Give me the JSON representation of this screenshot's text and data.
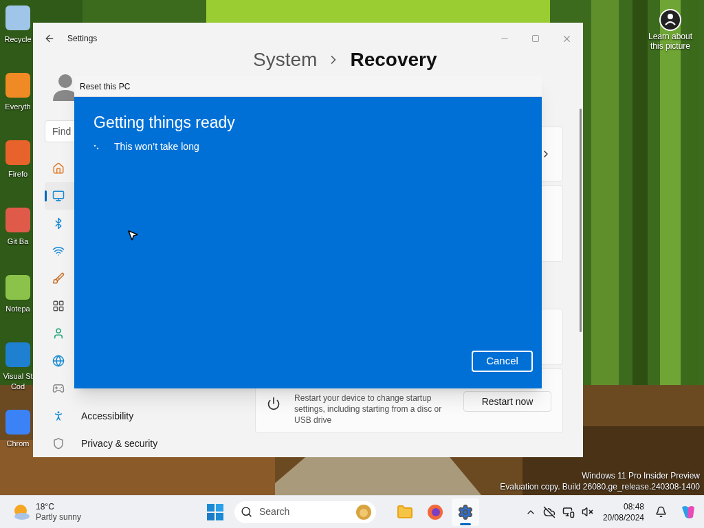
{
  "desktop": {
    "icons": [
      {
        "label": "Recycle"
      },
      {
        "label": "Everyth"
      },
      {
        "label": "Firefo"
      },
      {
        "label": "Git Ba"
      },
      {
        "label": "Notepa"
      },
      {
        "label": "Visual St\nCod"
      },
      {
        "label": "Chrom"
      }
    ],
    "learn_picture": "Learn about this picture",
    "build_notice": [
      "Windows 11 Pro Insider Preview",
      "Evaluation copy. Build 26080.ge_release.240308-1400"
    ]
  },
  "settings_window": {
    "title": "Settings",
    "search": {
      "placeholder": "Find"
    },
    "breadcrumb": [
      "System",
      "Recovery"
    ],
    "nav": [
      {
        "selected": false
      },
      {
        "selected": true
      },
      {
        "selected": false
      },
      {
        "selected": false
      },
      {
        "selected": false
      },
      {
        "selected": false
      },
      {
        "selected": false
      },
      {
        "selected": false
      },
      {
        "selected": false
      },
      {
        "label": "Accessibility",
        "selected": false
      },
      {
        "label": "Privacy & security",
        "selected": false
      }
    ],
    "advanced_startup": {
      "description": "Restart your device to change startup settings, including starting from a disc or USB drive",
      "button": "Restart now"
    }
  },
  "dialog": {
    "title": "Reset this PC",
    "heading": "Getting things ready",
    "status": "This won’t take long",
    "cancel": "Cancel"
  },
  "taskbar": {
    "weather": {
      "temperature": "18°C",
      "condition": "Partly sunny"
    },
    "search": {
      "placeholder": "Search"
    },
    "apps": [
      {
        "selected": false
      },
      {
        "selected": false
      },
      {
        "selected": true
      }
    ],
    "clock": {
      "time": "08:48",
      "date": "20/08/2024"
    }
  }
}
